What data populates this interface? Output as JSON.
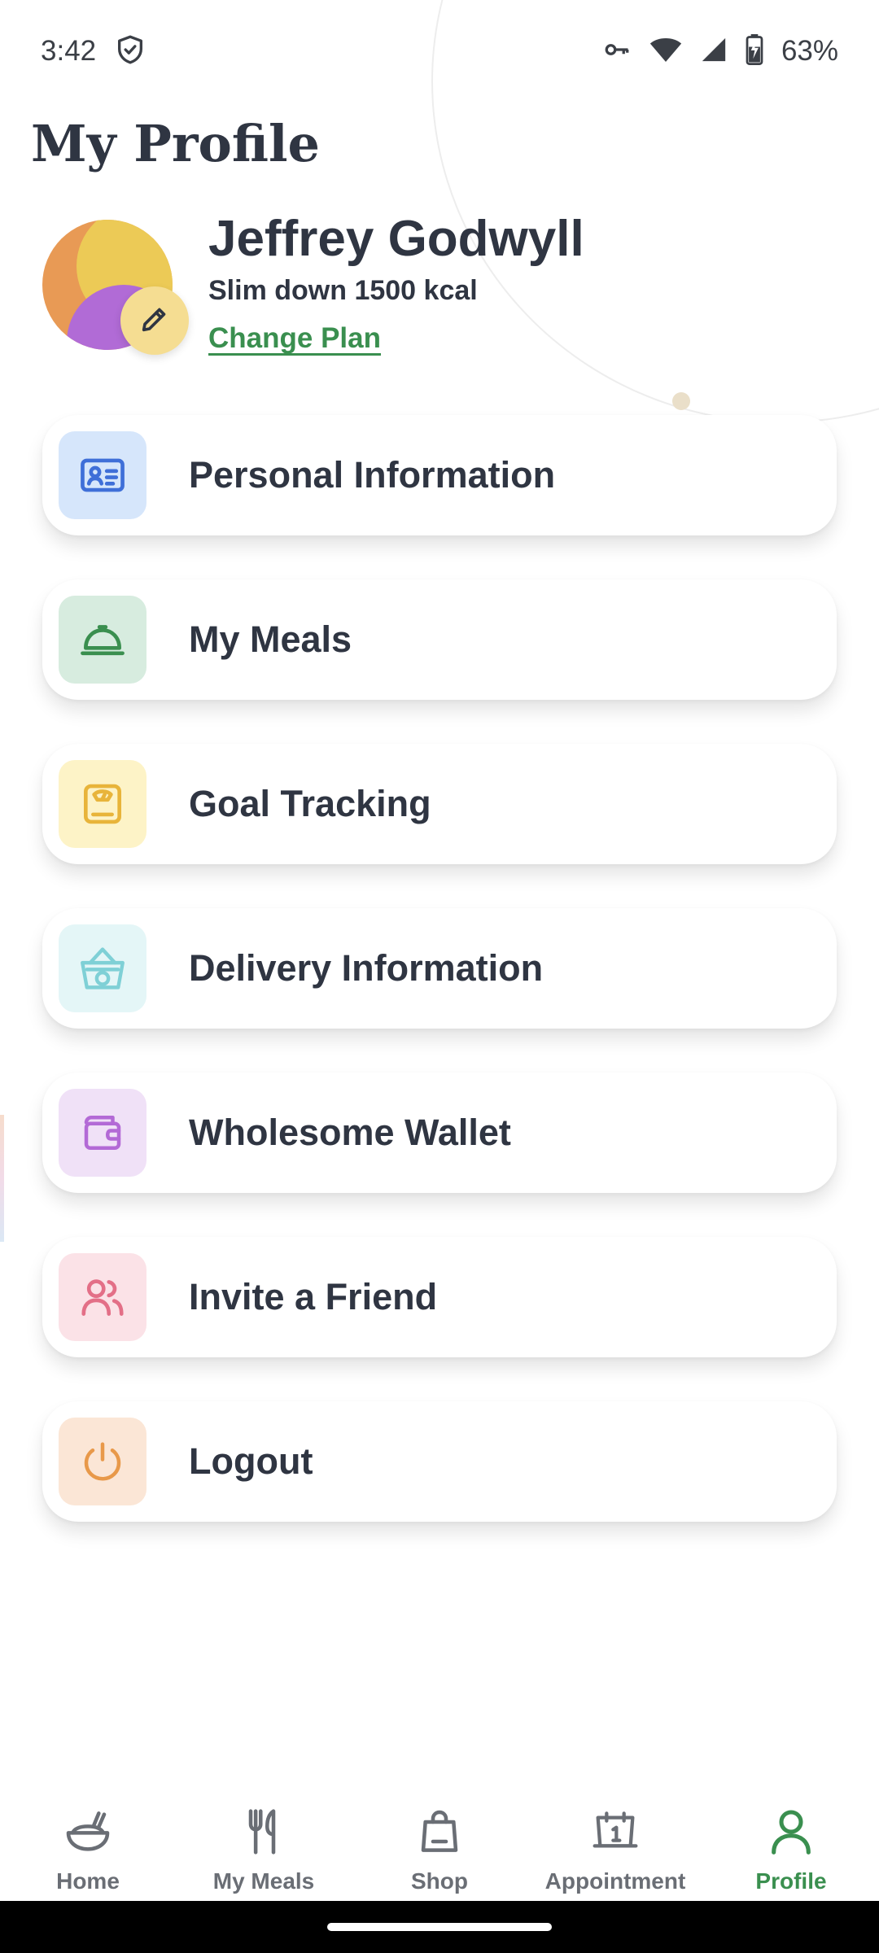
{
  "status_bar": {
    "time": "3:42",
    "battery": "63%",
    "icons": [
      "shield-check-icon",
      "vpn-key-icon",
      "wifi-icon",
      "signal-icon",
      "battery-charging-icon"
    ]
  },
  "page": {
    "title": "My Profile"
  },
  "profile": {
    "name": "Jeffrey Godwyll",
    "plan": "Slim down 1500 kcal",
    "change_plan_label": "Change Plan"
  },
  "menu": {
    "items": [
      {
        "label": "Personal Information",
        "icon": "id-card-icon",
        "icon_color": "#3f6fd8",
        "icon_bg": "#d6e6fb"
      },
      {
        "label": "My Meals",
        "icon": "cloche-icon",
        "icon_color": "#3a8f4f",
        "icon_bg": "#d7ecdf"
      },
      {
        "label": "Goal Tracking",
        "icon": "scale-icon",
        "icon_color": "#e8b43a",
        "icon_bg": "#fdf3c7"
      },
      {
        "label": "Delivery Information",
        "icon": "basket-icon",
        "icon_color": "#7fd0d6",
        "icon_bg": "#e4f6f7"
      },
      {
        "label": "Wholesome Wallet",
        "icon": "wallet-icon",
        "icon_color": "#b36ad6",
        "icon_bg": "#f0e1f7"
      },
      {
        "label": "Invite a Friend",
        "icon": "users-icon",
        "icon_color": "#e36f87",
        "icon_bg": "#fbe2e7"
      },
      {
        "label": "Logout",
        "icon": "power-icon",
        "icon_color": "#e8994a",
        "icon_bg": "#fbe6d6"
      }
    ]
  },
  "bottom_nav": {
    "items": [
      {
        "label": "Home",
        "icon": "bowl-icon",
        "active": false
      },
      {
        "label": "My Meals",
        "icon": "fork-knife-icon",
        "active": false
      },
      {
        "label": "Shop",
        "icon": "shopping-bag-icon",
        "active": false
      },
      {
        "label": "Appointment",
        "icon": "calendar-icon",
        "active": false
      },
      {
        "label": "Profile",
        "icon": "person-icon",
        "active": true
      }
    ],
    "active_color": "#3a8f4f",
    "inactive_color": "#6a6e75"
  }
}
